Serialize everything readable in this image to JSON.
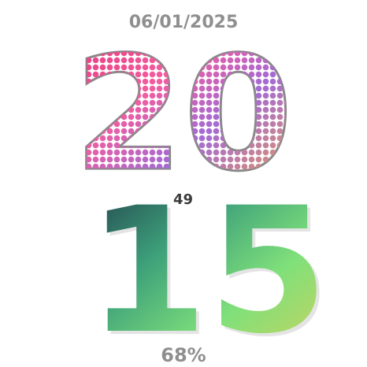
{
  "watchface": {
    "date": "06/01/2025",
    "hour": "20",
    "minute": "15",
    "seconds": "49",
    "battery": "68%"
  },
  "colors": {
    "hour_gradient": [
      "#e8367a",
      "#f25da0",
      "#9b6cd9",
      "#f0a24b"
    ],
    "minute_gradient": [
      "#1e3446",
      "#3da07a",
      "#7fe07a",
      "#d9d05a"
    ],
    "label_gray": "#8f8f8f"
  }
}
